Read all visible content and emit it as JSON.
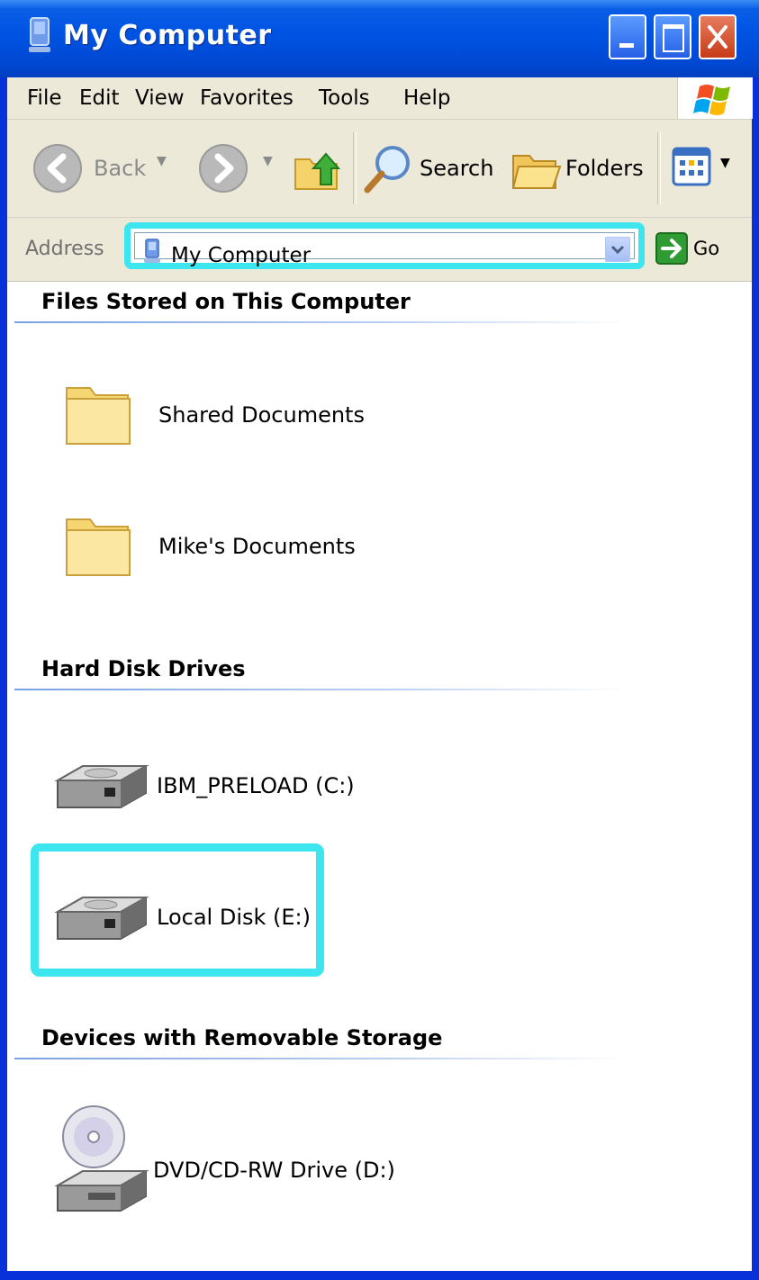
{
  "window": {
    "title": "My Computer"
  },
  "menu": {
    "items": [
      "File",
      "Edit",
      "View",
      "Favorites",
      "Tools",
      "Help"
    ]
  },
  "toolbar": {
    "back_label": "Back",
    "search_label": "Search",
    "folders_label": "Folders"
  },
  "address": {
    "label": "Address",
    "value": "My Computer",
    "go_label": "Go"
  },
  "groups": [
    {
      "title": "Files Stored on This Computer",
      "items": [
        "Shared Documents",
        "Mike's Documents"
      ]
    },
    {
      "title": "Hard Disk Drives",
      "items": [
        "IBM_PRELOAD (C:)",
        "Local Disk (E:)"
      ]
    },
    {
      "title": "Devices with Removable Storage",
      "items": [
        "DVD/CD-RW Drive (D:)"
      ]
    }
  ],
  "colors": {
    "highlight": "#3de6ef",
    "titlebar": "#0054e3",
    "chrome": "#ece9d8"
  },
  "icons": {
    "title": "my-computer-icon",
    "folder": "folder-icon",
    "drive": "hard-drive-icon",
    "dvd": "dvd-drive-icon"
  }
}
